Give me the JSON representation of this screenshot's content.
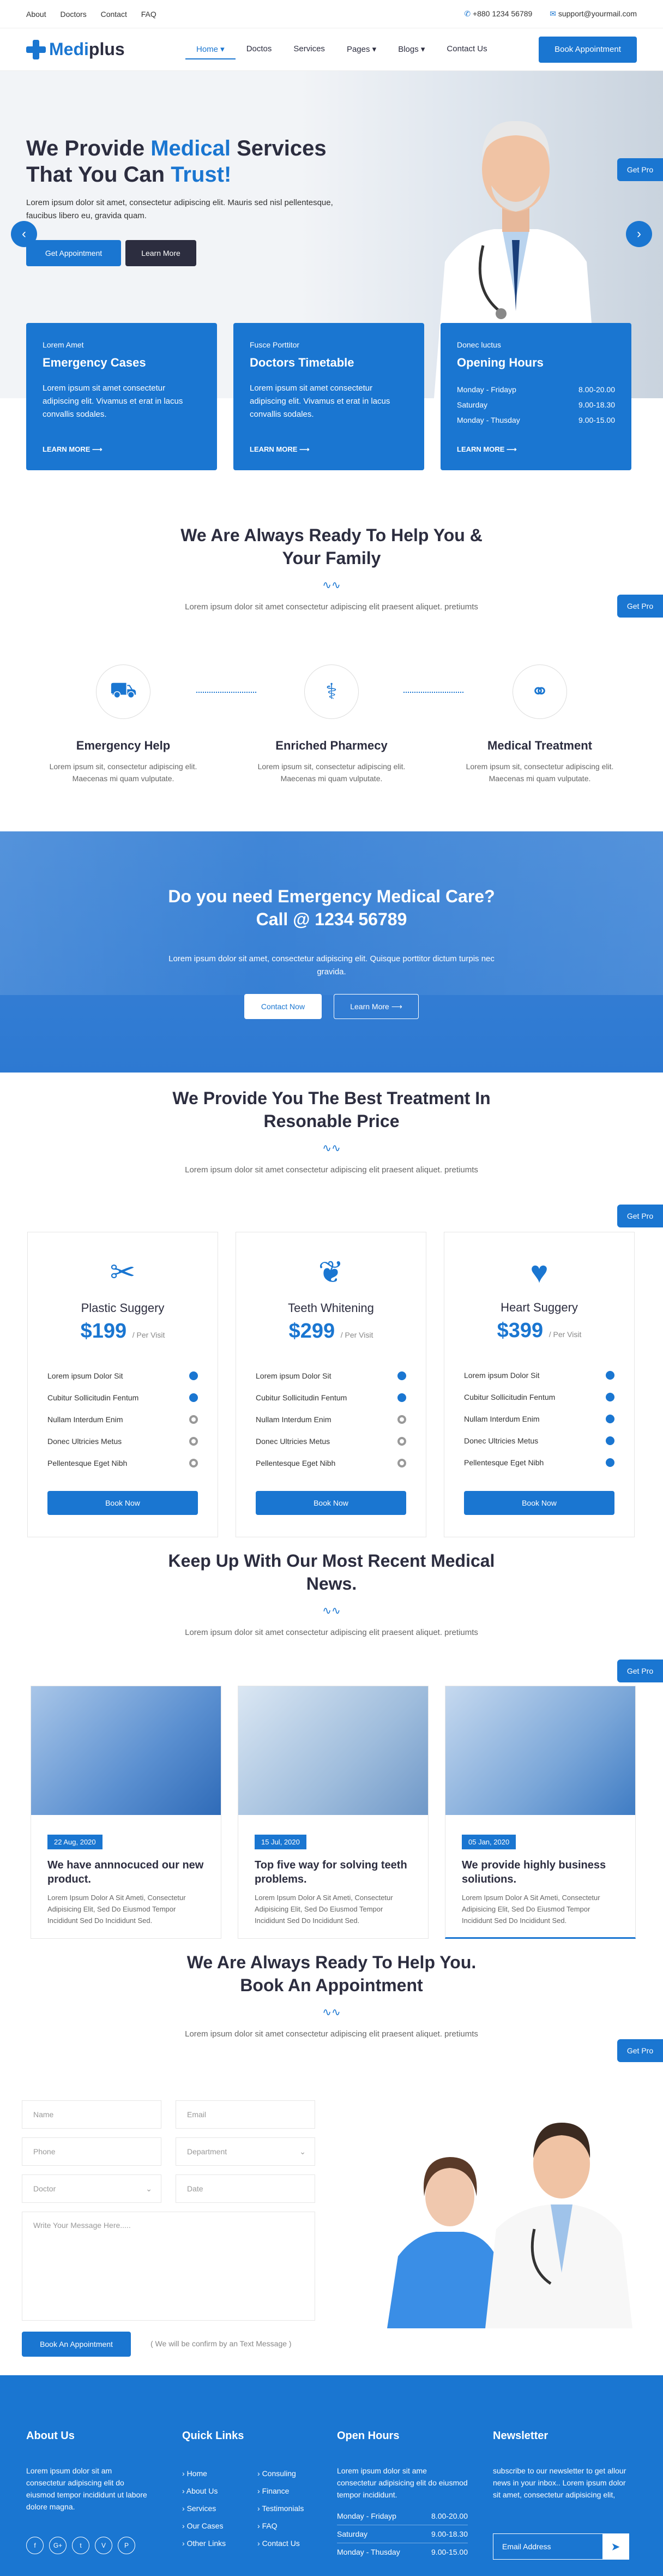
{
  "topbar": {
    "links": [
      "About",
      "Doctors",
      "Contact",
      "FAQ"
    ],
    "phone": "+880 1234 56789",
    "email": "support@yourmail.com"
  },
  "nav": {
    "logo_prefix": "Medi",
    "logo_suffix": "plus",
    "items": [
      "Home",
      "Doctos",
      "Services",
      "Pages",
      "Blogs",
      "Contact Us"
    ],
    "cta": "Book Appointment"
  },
  "hero": {
    "title_1": "We Provide ",
    "title_highlight_1": "Medical",
    "title_2": " Services That You Can ",
    "title_highlight_2": "Trust!",
    "text": "Lorem ipsum dolor sit amet, consectetur adipiscing elit. Mauris sed nisl pellentesque, faucibus libero eu, gravida quam.",
    "btn_primary": "Get Appointment",
    "btn_secondary": "Learn More",
    "get_pro": "Get Pro"
  },
  "cards": [
    {
      "small": "Lorem Amet",
      "title": "Emergency Cases",
      "text": "Lorem ipsum sit amet consectetur adipiscing elit. Vivamus et erat in lacus convallis sodales.",
      "link": "LEARN MORE"
    },
    {
      "small": "Fusce Porttitor",
      "title": "Doctors Timetable",
      "text": "Lorem ipsum sit amet consectetur adipiscing elit. Vivamus et erat in lacus convallis sodales.",
      "link": "LEARN MORE"
    },
    {
      "small": "Donec luctus",
      "title": "Opening Hours",
      "hours": [
        [
          "Monday - Fridayp",
          "8.00-20.00"
        ],
        [
          "Saturday",
          "9.00-18.30"
        ],
        [
          "Monday - Thusday",
          "9.00-15.00"
        ]
      ],
      "link": "LEARN MORE"
    }
  ],
  "help": {
    "title": "We Are Always Ready To Help You & Your Family",
    "text": "Lorem ipsum dolor sit amet consectetur adipiscing elit praesent aliquet. pretiumts",
    "features": [
      {
        "title": "Emergency Help",
        "text": "Lorem ipsum sit, consectetur adipiscing elit. Maecenas mi quam vulputate."
      },
      {
        "title": "Enriched Pharmecy",
        "text": "Lorem ipsum sit, consectetur adipiscing elit. Maecenas mi quam vulputate."
      },
      {
        "title": "Medical Treatment",
        "text": "Lorem ipsum sit, consectetur adipiscing elit. Maecenas mi quam vulputate."
      }
    ]
  },
  "cta": {
    "title": "Do you need Emergency Medical Care? Call @ 1234 56789",
    "text": "Lorem ipsum dolor sit amet, consectetur adipiscing elit. Quisque porttitor dictum turpis nec gravida.",
    "btn_contact": "Contact Now",
    "btn_learn": "Learn More"
  },
  "pricing": {
    "title": "We Provide You The Best Treatment In Resonable Price",
    "text": "Lorem ipsum dolor sit amet consectetur adipiscing elit praesent aliquet. pretiumts",
    "plans": [
      {
        "name": "Plastic Suggery",
        "price": "$199",
        "per": "/ Per Visit",
        "icon": "scissors-icon"
      },
      {
        "name": "Teeth Whitening",
        "price": "$299",
        "per": "/ Per Visit",
        "icon": "tooth-icon"
      },
      {
        "name": "Heart Suggery",
        "price": "$399",
        "per": "/ Per Visit",
        "icon": "heart-icon"
      }
    ],
    "features": [
      "Lorem ipsum Dolor Sit",
      "Cubitur Sollicitudin Fentum",
      "Nullam Interdum Enim",
      "Donec Ultricies Metus",
      "Pellentesque Eget Nibh"
    ],
    "checks": [
      [
        true,
        true,
        false,
        false,
        false
      ],
      [
        true,
        true,
        false,
        false,
        false
      ],
      [
        true,
        true,
        true,
        true,
        true
      ]
    ],
    "button": "Book Now"
  },
  "news": {
    "title": "Keep Up With Our Most Recent Medical News.",
    "text": "Lorem ipsum dolor sit amet consectetur adipiscing elit praesent aliquet. pretiumts",
    "items": [
      {
        "date": "22 Aug, 2020",
        "title": "We have annnocuced our new product.",
        "text": "Lorem Ipsum Dolor A Sit Ameti, Consectetur Adipisicing Elit, Sed Do Eiusmod Tempor Incididunt Sed Do Incididunt Sed."
      },
      {
        "date": "15 Jul, 2020",
        "title": "Top five way for solving teeth problems.",
        "text": "Lorem Ipsum Dolor A Sit Ameti, Consectetur Adipisicing Elit, Sed Do Eiusmod Tempor Incididunt Sed Do Incididunt Sed."
      },
      {
        "date": "05 Jan, 2020",
        "title": "We provide highly business soliutions.",
        "text": "Lorem Ipsum Dolor A Sit Ameti, Consectetur Adipisicing Elit, Sed Do Eiusmod Tempor Incididunt Sed Do Incididunt Sed."
      }
    ]
  },
  "appointment": {
    "title": "We Are Always Ready To Help You. Book An Appointment",
    "text": "Lorem ipsum dolor sit amet consectetur adipiscing elit praesent aliquet. pretiumts",
    "placeholders": {
      "name": "Name",
      "email": "Email",
      "phone": "Phone",
      "department": "Department",
      "doctor": "Doctor",
      "date": "Date",
      "message": "Write Your Message Here....."
    },
    "button": "Book An Appointment",
    "note": "( We will be confirm by an Text Message )"
  },
  "footer": {
    "about_title": "About Us",
    "about_text": "Lorem ipsum dolor sit am consectetur adipiscing elit do eiusmod tempor incididunt ut labore dolore magna.",
    "social": [
      "f",
      "G+",
      "t",
      "V",
      "P"
    ],
    "links_title": "Quick Links",
    "links_col1": [
      "Home",
      "About Us",
      "Services",
      "Our Cases",
      "Other Links"
    ],
    "links_col2": [
      "Consuling",
      "Finance",
      "Testimonials",
      "FAQ",
      "Contact Us"
    ],
    "hours_title": "Open Hours",
    "hours_text": "Lorem ipsum dolor sit ame consectetur adipisicing elit do eiusmod tempor incididunt.",
    "hours": [
      [
        "Monday - Fridayp",
        "8.00-20.00"
      ],
      [
        "Saturday",
        "9.00-18.30"
      ],
      [
        "Monday - Thusday",
        "9.00-15.00"
      ]
    ],
    "newsletter_title": "Newsletter",
    "newsletter_text": "subscribe to our newsletter to get allour news in your inbox.. Lorem ipsum dolor sit amet, consectetur adipisicing elit,",
    "email_placeholder": "Email Address"
  }
}
